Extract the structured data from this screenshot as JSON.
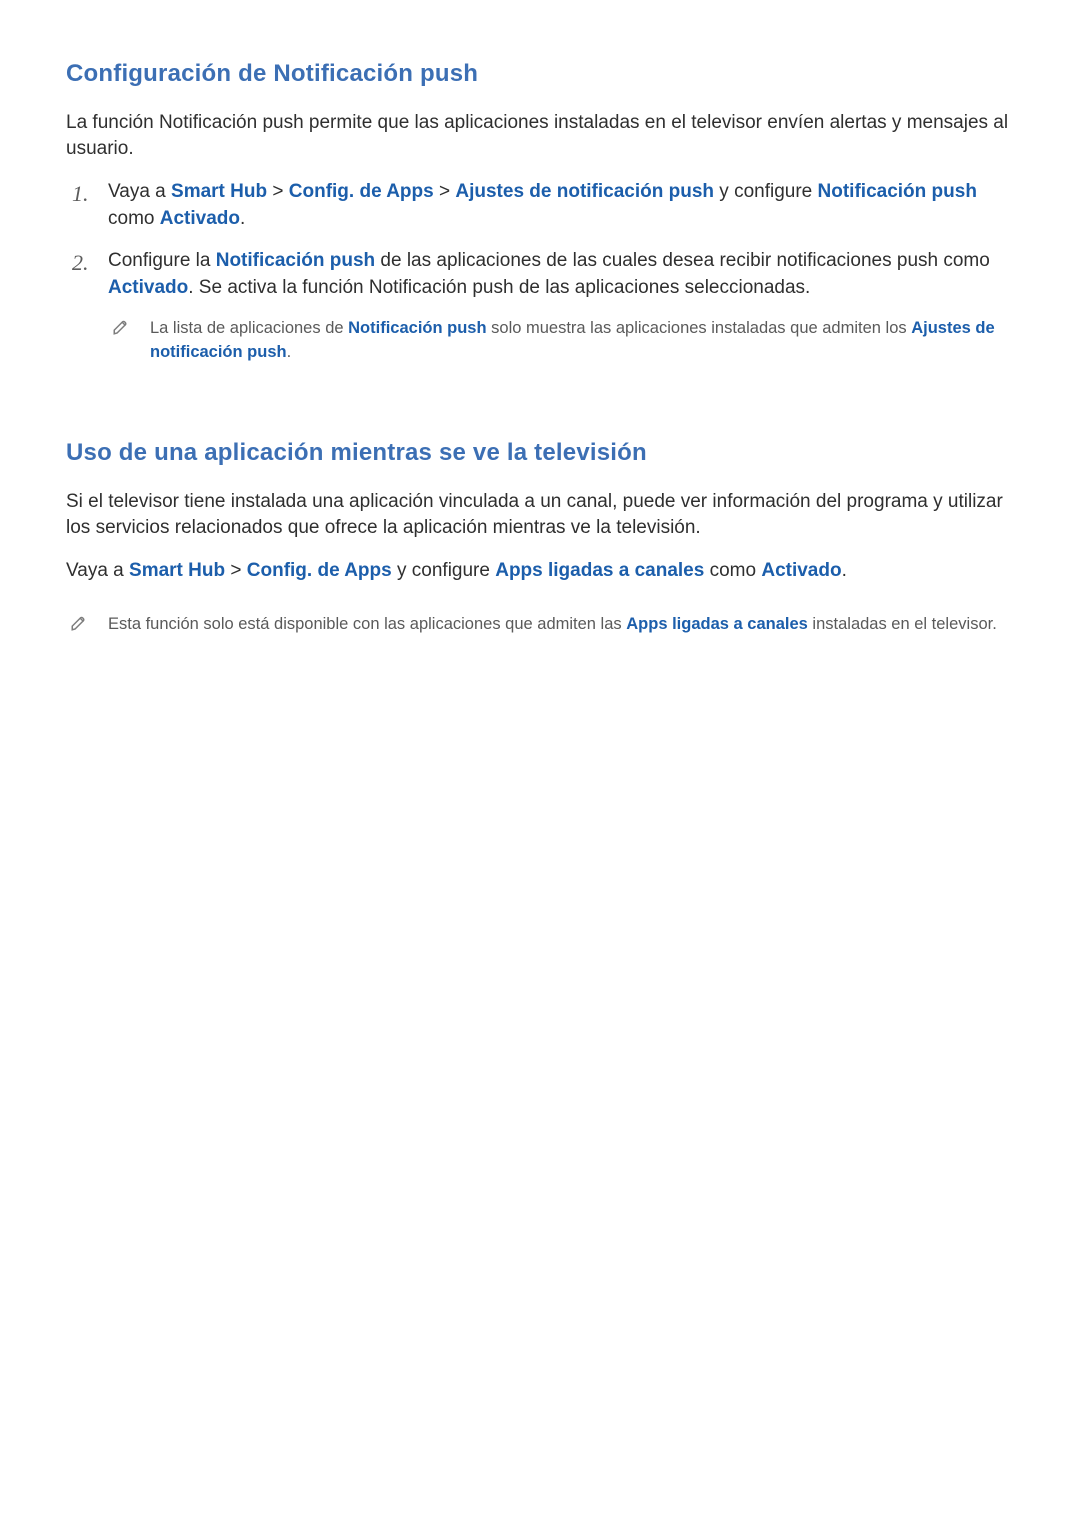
{
  "section1": {
    "heading": "Configuración de Notificación push",
    "intro": "La función Notificación push permite que las aplicaciones instaladas en el televisor envíen alertas y mensajes al usuario.",
    "step1": {
      "t1": "Vaya a ",
      "smart_hub": "Smart Hub",
      "gt1": " > ",
      "config_apps": "Config. de Apps",
      "gt2": " > ",
      "ajustes_push": "Ajustes de notificación push",
      "t2": " y configure ",
      "notif_push": "Notificación push",
      "t3": " como ",
      "activado": "Activado",
      "t4": "."
    },
    "step2": {
      "t1": "Configure la ",
      "notif_push": "Notificación push",
      "t2": " de las aplicaciones de las cuales desea recibir notificaciones push como ",
      "activado": "Activado",
      "t3": ". Se activa la función Notificación push de las aplicaciones seleccionadas."
    },
    "note": {
      "t1": "La lista de aplicaciones de ",
      "notif_push": "Notificación push",
      "t2": " solo muestra las aplicaciones instaladas que admiten los ",
      "ajustes_push": "Ajustes de notificación push",
      "t3": "."
    }
  },
  "section2": {
    "heading": "Uso de una aplicación mientras se ve la televisión",
    "intro": "Si el televisor tiene instalada una aplicación vinculada a un canal, puede ver información del programa y utilizar los servicios relacionados que ofrece la aplicación mientras ve la televisión.",
    "path": {
      "t1": "Vaya a ",
      "smart_hub": "Smart Hub",
      "gt1": " > ",
      "config_apps": "Config. de Apps",
      "t2": " y configure ",
      "apps_ligadas": "Apps ligadas a canales",
      "t3": " como ",
      "activado": "Activado",
      "t4": "."
    },
    "note": {
      "t1": "Esta función solo está disponible con las aplicaciones que admiten las ",
      "apps_ligadas": "Apps ligadas a canales",
      "t2": " instaladas en el televisor."
    }
  }
}
